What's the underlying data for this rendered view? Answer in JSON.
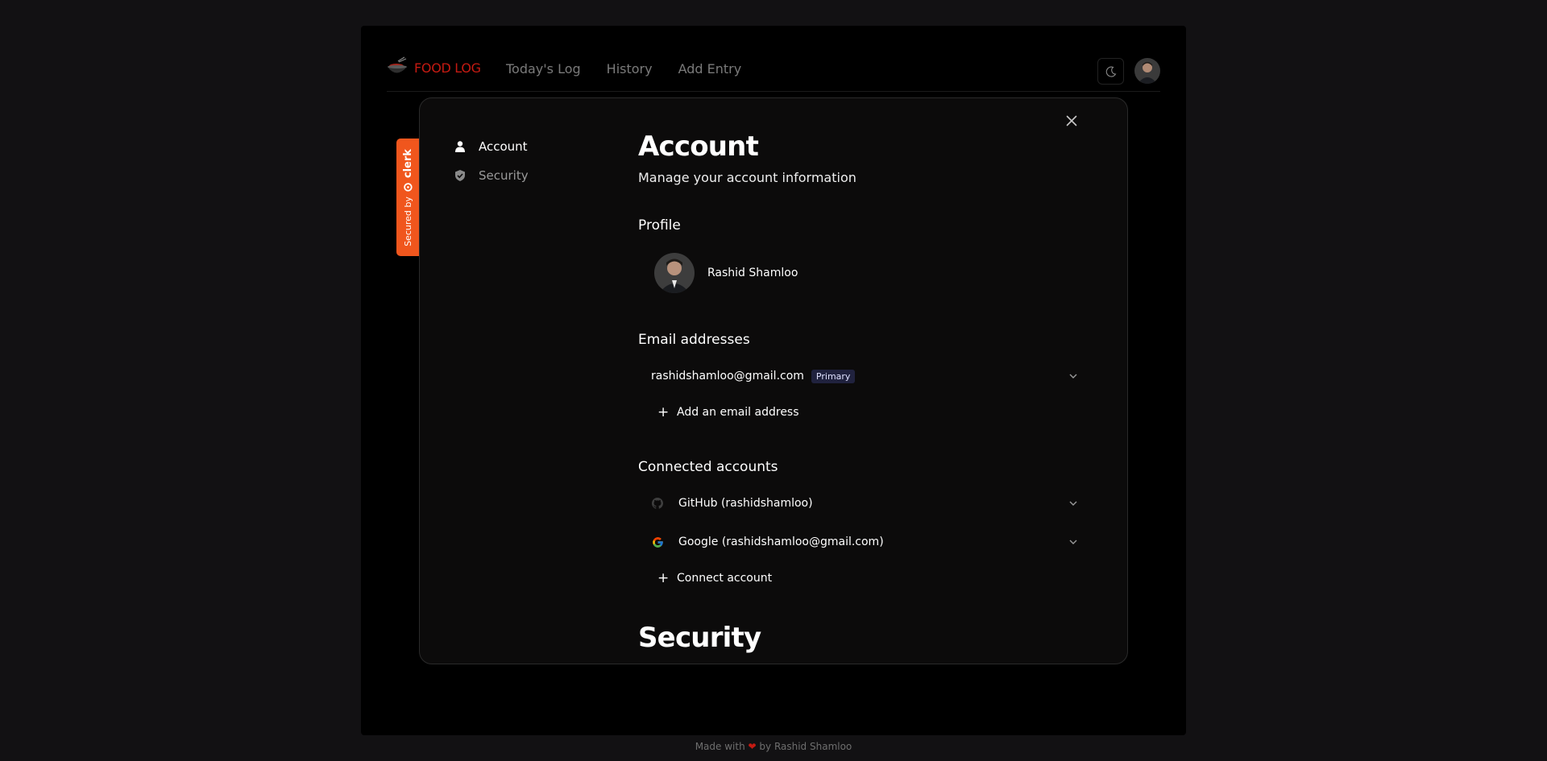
{
  "navbar": {
    "logo_text": "FOOD LOG",
    "links": [
      "Today's Log",
      "History",
      "Add Entry"
    ]
  },
  "clerk_badge": {
    "secured_by": "Secured by",
    "brand": "clerk"
  },
  "sidebar": {
    "items": [
      {
        "label": "Account",
        "icon": "user-icon",
        "active": true
      },
      {
        "label": "Security",
        "icon": "shield-icon",
        "active": false
      }
    ]
  },
  "account": {
    "title": "Account",
    "subtitle": "Manage your account information",
    "profile_section": "Profile",
    "profile_name": "Rashid Shamloo",
    "email_section": "Email addresses",
    "email": "rashidshamloo@gmail.com",
    "email_badge": "Primary",
    "add_email_label": "Add an email address",
    "connected_section": "Connected accounts",
    "connected": [
      {
        "provider": "GitHub",
        "label": "GitHub (rashidshamloo)",
        "icon": "github-icon"
      },
      {
        "provider": "Google",
        "label": "Google (rashidshamloo@gmail.com)",
        "icon": "google-icon"
      }
    ],
    "connect_label": "Connect account"
  },
  "security": {
    "title": "Security"
  },
  "footer": {
    "made_with": "Made with",
    "by": "by Rashid Shamloo"
  },
  "colors": {
    "brand_red": "#c41a12",
    "clerk_orange": "#f0561d",
    "primary_badge_bg": "#20223e"
  }
}
